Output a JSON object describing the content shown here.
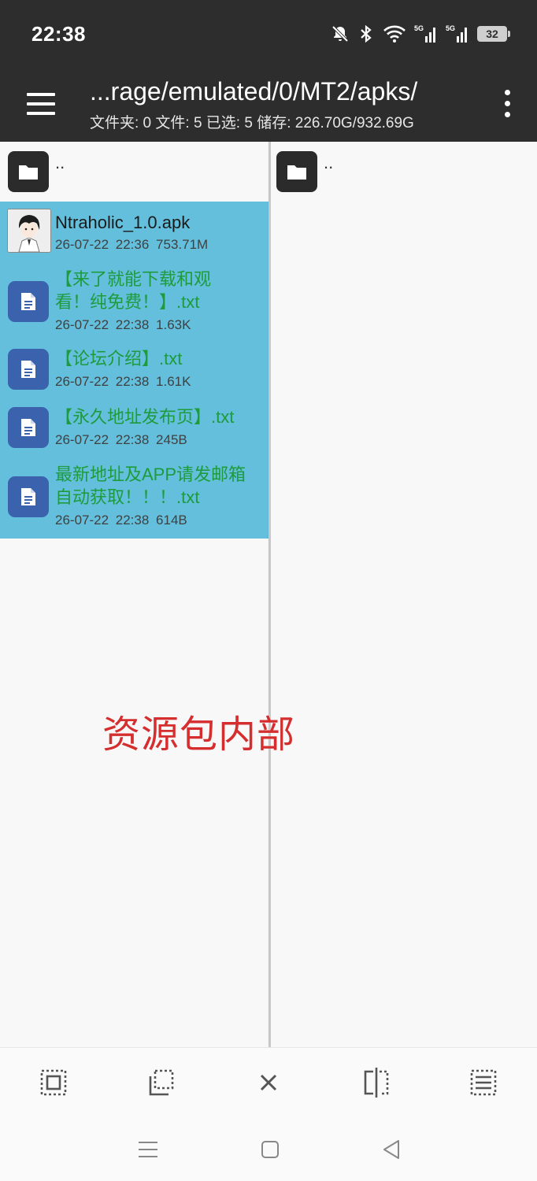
{
  "status_bar": {
    "time": "22:38",
    "icons": [
      "bell-off-icon",
      "bluetooth-icon",
      "wifi-icon",
      "signal-5g-icon",
      "signal-5g-icon",
      "battery-icon"
    ],
    "battery_level": "32"
  },
  "toolbar": {
    "path": "...rage/emulated/0/MT2/apks/",
    "summary": "文件夹: 0  文件: 5  已选: 5  储存: 226.70G/932.69G",
    "menu_icon": "hamburger-menu-icon",
    "overflow_icon": "more-vertical-icon"
  },
  "left_pane": {
    "parent_label": "..",
    "files": [
      {
        "name": "Ntraholic_1.0.apk",
        "meta": "26-07-22 22:36  753.71M",
        "icon": "apk-thumbnail",
        "selected": true
      },
      {
        "name": "【来了就能下载和观看！纯免费！】.txt",
        "meta": "26-07-22 22:38  1.63K",
        "icon": "document-icon",
        "selected": true
      },
      {
        "name": "【论坛介绍】.txt",
        "meta": "26-07-22 22:38  1.61K",
        "icon": "document-icon",
        "selected": true
      },
      {
        "name": "【永久地址发布页】.txt",
        "meta": "26-07-22 22:38  245B",
        "icon": "document-icon",
        "selected": true
      },
      {
        "name": "最新地址及APP请发邮箱自动获取！！！.txt",
        "meta": "26-07-22 22:38  614B",
        "icon": "document-icon",
        "selected": true
      }
    ]
  },
  "right_pane": {
    "parent_label": ".."
  },
  "overlay_text": "资源包内部",
  "bottom_actions": [
    "select-all-icon",
    "select-copy-icon",
    "close-icon",
    "split-view-icon",
    "list-select-icon"
  ],
  "nav_bar": [
    "recents-icon",
    "home-icon",
    "back-icon"
  ],
  "colors": {
    "bar": "#2d2d2d",
    "selection": "#63bfdc",
    "text_file_name": "#1e9b3c",
    "doc_icon": "#3b62ad",
    "overlay": "#d42e2e"
  }
}
